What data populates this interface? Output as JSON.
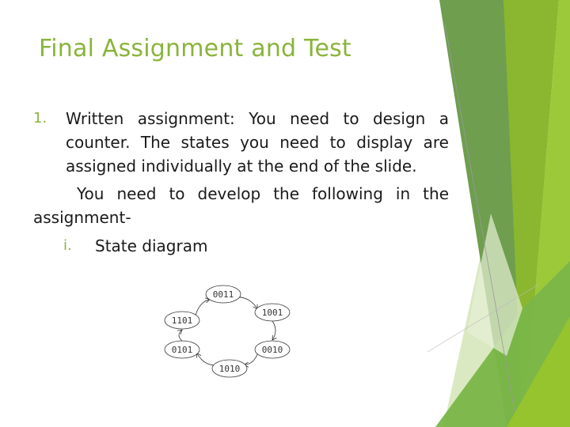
{
  "slide": {
    "title": "Final Assignment and Test",
    "accent_color": "#8ab43a",
    "items": [
      {
        "number": "1.",
        "text": "Written assignment: You need to design a counter. The states you need to display are assigned individually at the end of the slide."
      }
    ],
    "paragraph": "You need to develop the following in the assignment-",
    "sub_items": [
      {
        "number": "i.",
        "text": "State diagram"
      }
    ],
    "state_diagram": {
      "states": [
        "0011",
        "1001",
        "0010",
        "1010",
        "0101",
        "1101"
      ],
      "transitions": [
        [
          "0011",
          "1001"
        ],
        [
          "1001",
          "0010"
        ],
        [
          "0010",
          "1010"
        ],
        [
          "1010",
          "0101"
        ],
        [
          "0101",
          "1101"
        ],
        [
          "1101",
          "0011"
        ]
      ]
    },
    "theme_colors": [
      "#6e9e4e",
      "#8ab72f",
      "#9cc93a",
      "#7ab648",
      "#dbe9c2"
    ]
  }
}
